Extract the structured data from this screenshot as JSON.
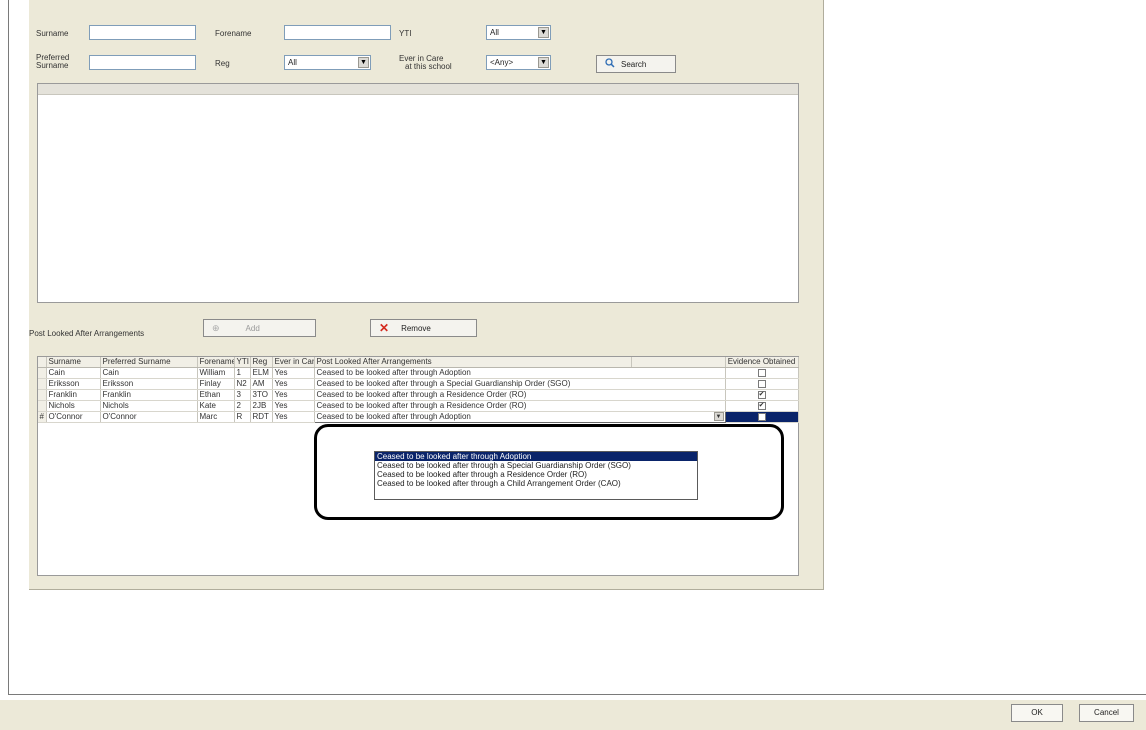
{
  "filters": {
    "surname_label": "Surname",
    "surname_value": "",
    "forename_label": "Forename",
    "forename_value": "",
    "yti_label": "YTI",
    "yti_value": "All",
    "preferred_surname_label_1": "Preferred",
    "preferred_surname_label_2": "Surname",
    "preferred_surname_value": "",
    "reg_label": "Reg",
    "reg_value": "All",
    "ever_in_care_label_1": "Ever in Care",
    "ever_in_care_label_2": "at this school",
    "ever_in_care_value": "<Any>",
    "search_label": "Search"
  },
  "arrangements": {
    "label": "Post Looked After Arrangements",
    "add_label": "Add",
    "remove_label": "Remove"
  },
  "grid": {
    "columns": [
      "Surname",
      "Preferred Surname",
      "Forename",
      "YTI",
      "Reg",
      "Ever in Care",
      "Post Looked After Arrangements",
      "Evidence Obtained"
    ],
    "rows": [
      {
        "marker": "",
        "surname": "Cain",
        "preferred": "Cain",
        "forename": "William",
        "yti": "1",
        "reg": "ELM",
        "ever": "Yes",
        "arrangement": "Ceased to be looked after through Adoption",
        "evidence": false
      },
      {
        "marker": "",
        "surname": "Eriksson",
        "preferred": "Eriksson",
        "forename": "Finlay",
        "yti": "N2",
        "reg": "AM",
        "ever": "Yes",
        "arrangement": "Ceased to be looked after through a Special Guardianship Order (SGO)",
        "evidence": false
      },
      {
        "marker": "",
        "surname": "Franklin",
        "preferred": "Franklin",
        "forename": "Ethan",
        "yti": "3",
        "reg": "3TO",
        "ever": "Yes",
        "arrangement": "Ceased to be looked after through a Residence Order (RO)",
        "evidence": true
      },
      {
        "marker": "",
        "surname": "Nichols",
        "preferred": "Nichols",
        "forename": "Kate",
        "yti": "2",
        "reg": "2JB",
        "ever": "Yes",
        "arrangement": "Ceased to be looked after through a Residence Order (RO)",
        "evidence": true
      },
      {
        "marker": "#",
        "surname": "O'Connor",
        "preferred": "O'Connor",
        "forename": "Marc",
        "yti": "R",
        "reg": "RDT",
        "ever": "Yes",
        "arrangement": "Ceased to be looked after through Adoption",
        "evidence": false
      }
    ]
  },
  "dropdown": {
    "options": [
      "Ceased to be looked after through Adoption",
      "Ceased to be looked after through a Special Guardianship Order (SGO)",
      "Ceased to be looked after through a Residence Order (RO)",
      "Ceased to be looked after through a Child Arrangement Order (CAO)"
    ],
    "selected_index": 0
  },
  "footer": {
    "ok_label": "OK",
    "cancel_label": "Cancel"
  }
}
